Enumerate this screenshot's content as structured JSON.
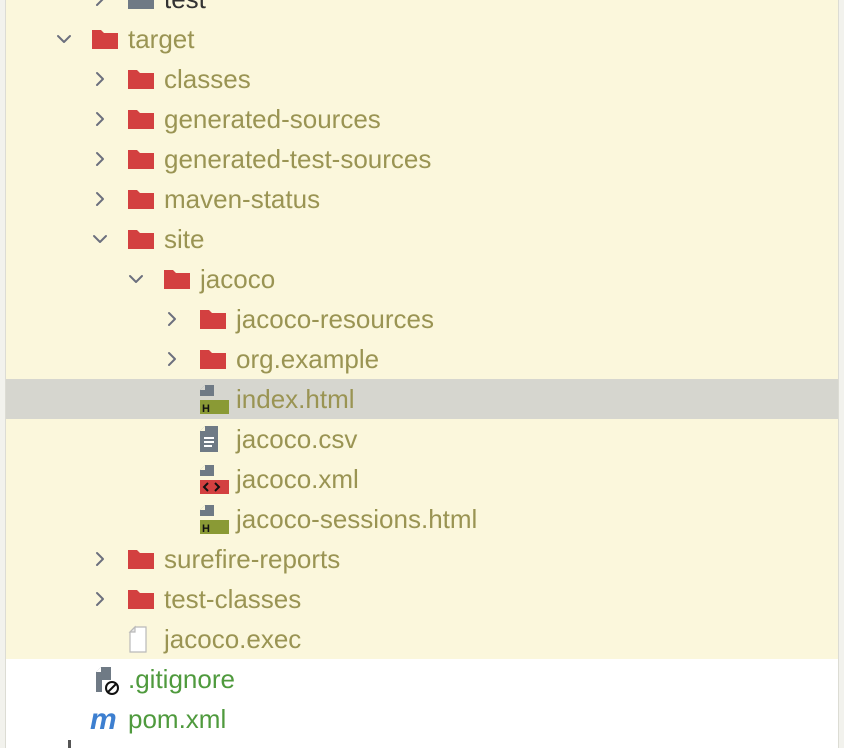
{
  "colors": {
    "excluded_text": "#9a9453",
    "vcs_new_text": "#4f9a3d",
    "folder_red": "#d34040",
    "highlight_bg": "#fbf7dc",
    "selection_bg": "#d6d6cf"
  },
  "tree": [
    {
      "label": "test",
      "icon": "folder-grey-icon",
      "expand": "expanded",
      "state": "highlight"
    },
    {
      "label": "target",
      "icon": "folder-icon",
      "expand": "expanded",
      "state": "highlight"
    },
    {
      "label": "classes",
      "icon": "folder-icon",
      "expand": "collapsed",
      "state": "highlight"
    },
    {
      "label": "generated-sources",
      "icon": "folder-icon",
      "expand": "collapsed",
      "state": "highlight"
    },
    {
      "label": "generated-test-sources",
      "icon": "folder-icon",
      "expand": "collapsed",
      "state": "highlight"
    },
    {
      "label": "maven-status",
      "icon": "folder-icon",
      "expand": "collapsed",
      "state": "highlight"
    },
    {
      "label": "site",
      "icon": "folder-icon",
      "expand": "expanded",
      "state": "highlight"
    },
    {
      "label": "jacoco",
      "icon": "folder-icon",
      "expand": "expanded",
      "state": "highlight"
    },
    {
      "label": "jacoco-resources",
      "icon": "folder-icon",
      "expand": "collapsed",
      "state": "highlight"
    },
    {
      "label": "org.example",
      "icon": "folder-icon",
      "expand": "collapsed",
      "state": "highlight"
    },
    {
      "label": "index.html",
      "icon": "html-file-icon",
      "expand": "none",
      "state": "selected"
    },
    {
      "label": "jacoco.csv",
      "icon": "csv-file-icon",
      "expand": "none",
      "state": "highlight"
    },
    {
      "label": "jacoco.xml",
      "icon": "xml-file-icon",
      "expand": "none",
      "state": "highlight"
    },
    {
      "label": "jacoco-sessions.html",
      "icon": "html-file-icon",
      "expand": "none",
      "state": "highlight"
    },
    {
      "label": "surefire-reports",
      "icon": "folder-icon",
      "expand": "collapsed",
      "state": "highlight"
    },
    {
      "label": "test-classes",
      "icon": "folder-icon",
      "expand": "collapsed",
      "state": "highlight"
    },
    {
      "label": "jacoco.exec",
      "icon": "blank-file-icon",
      "expand": "none",
      "state": "highlight"
    },
    {
      "label": ".gitignore",
      "icon": "gitignore-file-icon",
      "expand": "none",
      "state": "normal",
      "text": "green"
    },
    {
      "label": "pom.xml",
      "icon": "maven-icon",
      "expand": "none",
      "state": "normal",
      "text": "green"
    }
  ]
}
